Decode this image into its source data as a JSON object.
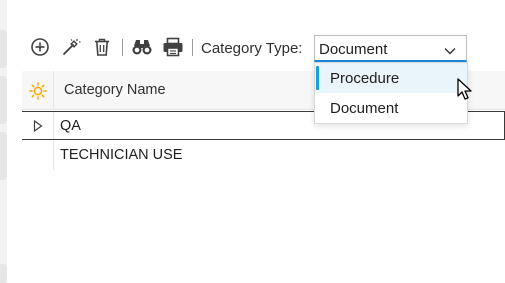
{
  "toolbar": {
    "category_type_label": "Category Type:",
    "buttons": [
      "add",
      "auto-magic",
      "delete",
      "find",
      "print"
    ]
  },
  "category_type_combo": {
    "value": "Document",
    "options": [
      "Procedure",
      "Document"
    ],
    "highlighted_option": "Procedure"
  },
  "grid": {
    "column_header": "Category Name",
    "rows": [
      {
        "name": "QA"
      },
      {
        "name": "TECHNICIAN USE"
      }
    ]
  },
  "colors": {
    "accent": "#1aa0d8",
    "combo_underline": "#1e88e5",
    "header_icon": "#f2a900"
  }
}
